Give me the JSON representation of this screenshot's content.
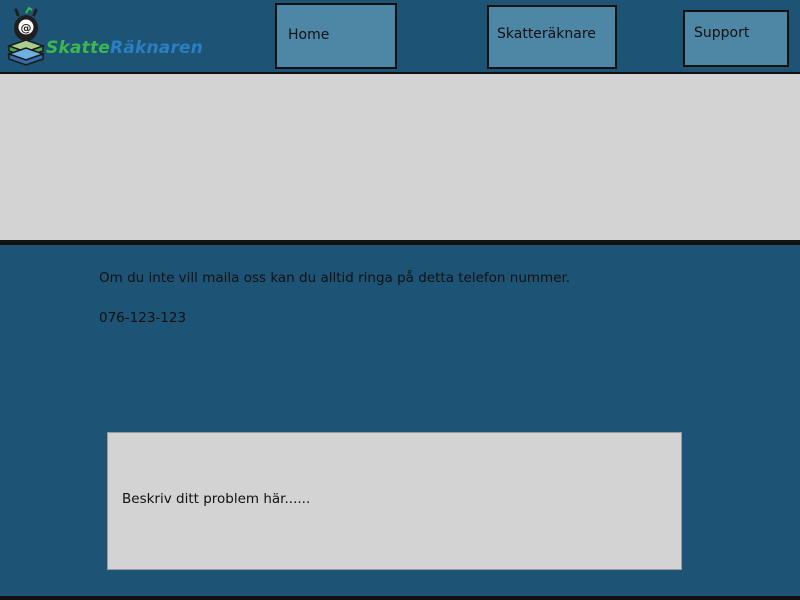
{
  "header": {
    "logo": {
      "icon": "owl-mascot-at-sign-icon",
      "text_part1": "Skatte",
      "text_part2": "Räknaren"
    },
    "nav": {
      "home": "Home",
      "calculator": "Skatteräknare",
      "support": "Support"
    }
  },
  "content": {
    "info_text": "Om du inte vill maila oss kan du alltid ringa på detta telefon nummer.",
    "phone": "076-123-123",
    "problem_placeholder": "Beskriv ditt problem här......"
  },
  "colors": {
    "background": "#1d5475",
    "nav_button": "#4e87a6",
    "panel": "#d3d3d3",
    "logo_green": "#3cb84e",
    "logo_blue": "#2a7fc3"
  }
}
